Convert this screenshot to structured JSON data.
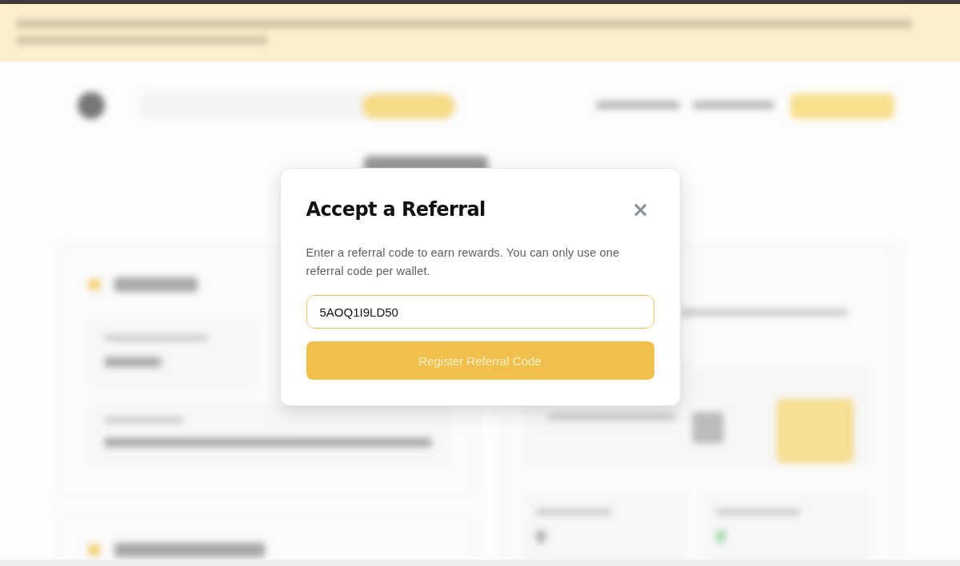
{
  "dialog": {
    "title": "Accept a Referral",
    "close": "×",
    "description": "Enter a referral code to earn rewards. You can only use one referral code per wallet.",
    "code_field": {
      "value": "5AOQ1I9LD50",
      "focused": true
    },
    "submit": {
      "label": "Register Referral Code",
      "disabled": true
    }
  }
}
